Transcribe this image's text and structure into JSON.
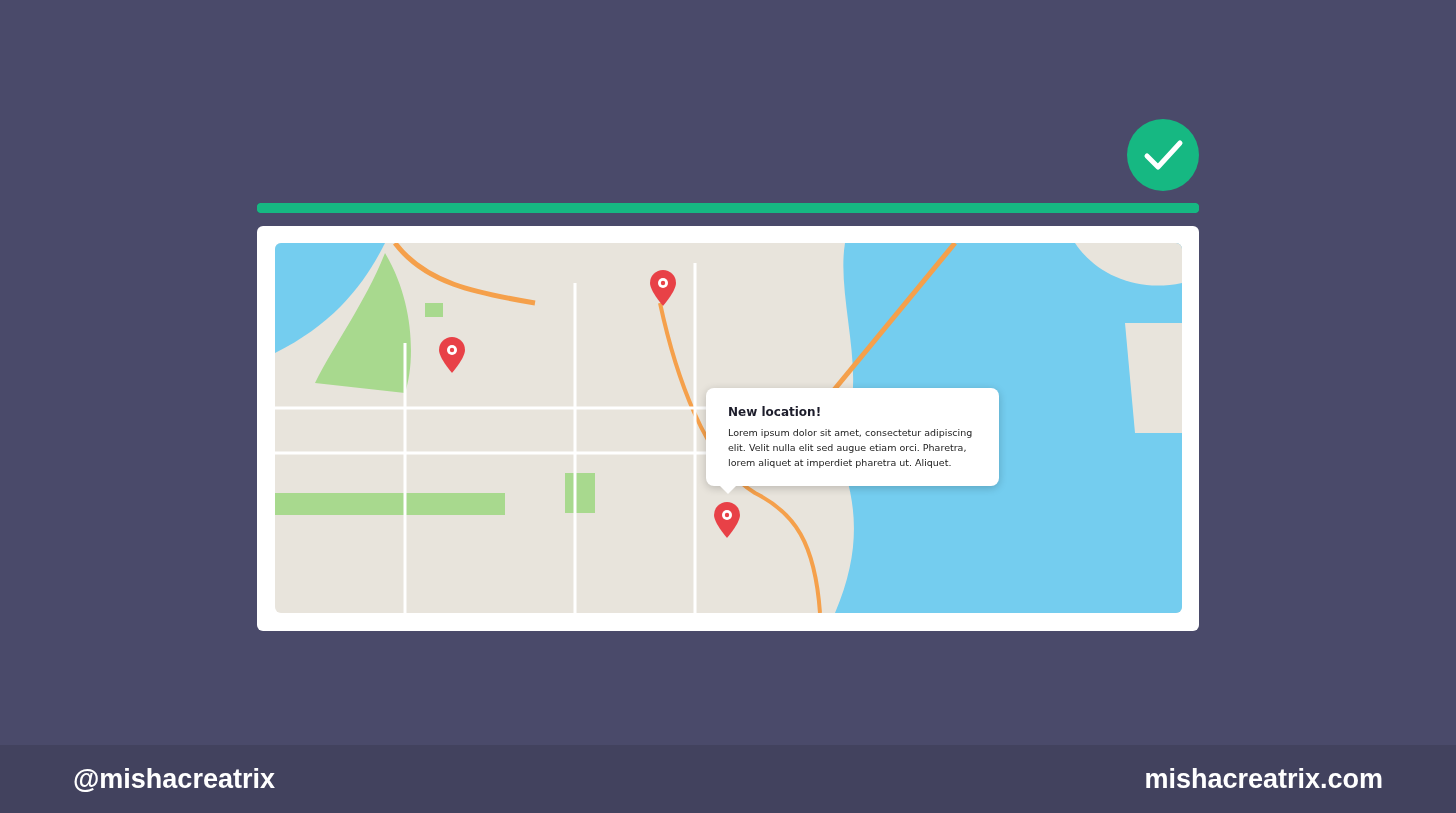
{
  "status": {
    "kind": "success"
  },
  "progress": {
    "level": 1
  },
  "map": {
    "kind": "picture",
    "pins": [
      {
        "kind": "pin"
      },
      {
        "kind": "pin"
      },
      {
        "kind": "pin"
      }
    ],
    "popup": {
      "title": "New location!",
      "text": "Lorem ipsum dolor sit amet, consectetur adipiscing elit. Velit nulla elit sed augue etiam orci. Pharetra, lorem aliquet at imperdiet pharetra ut. Aliquet."
    }
  },
  "footer": {
    "handle": "@mishacreatrix",
    "site": "mishacreatrix.com"
  }
}
